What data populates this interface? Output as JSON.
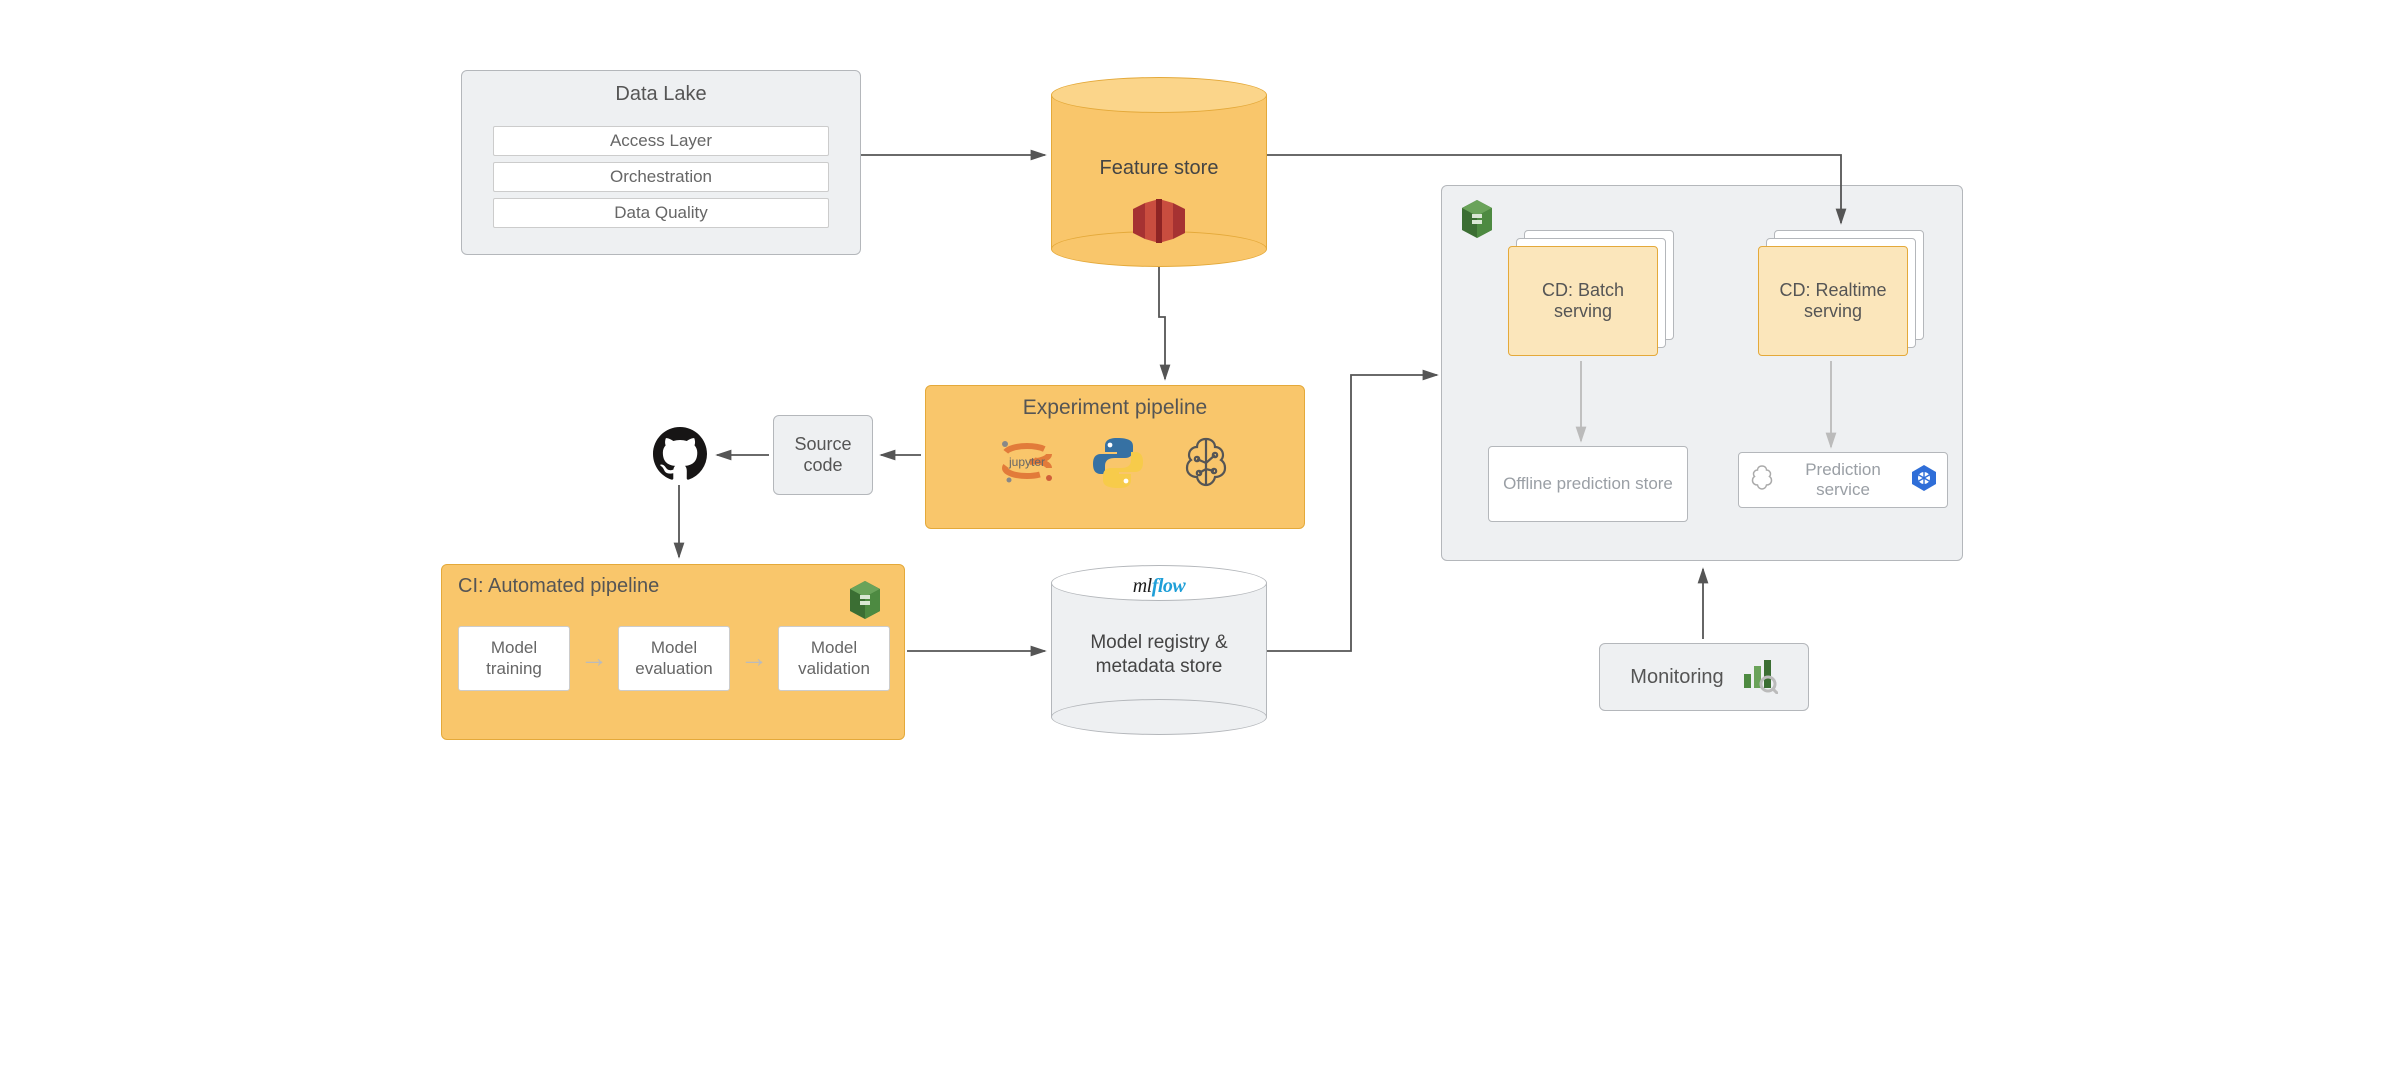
{
  "datalake": {
    "title": "Data Lake",
    "layers": [
      "Access Layer",
      "Orchestration",
      "Data Quality"
    ]
  },
  "feature_store": {
    "label": "Feature store"
  },
  "experiment": {
    "title": "Experiment pipeline",
    "icons": [
      "jupyter",
      "python",
      "ml-brain"
    ]
  },
  "source_code": {
    "label_line1": "Source",
    "label_line2": "code"
  },
  "ci": {
    "title": "CI: Automated pipeline",
    "stages": [
      "Model training",
      "Model evaluation",
      "Model validation"
    ]
  },
  "model_registry": {
    "logo": "mlflow",
    "label": "Model registry & metadata store"
  },
  "deploy": {
    "batch": "CD: Batch serving",
    "realtime": "CD: Realtime serving",
    "offline_pred": "Offline prediction store",
    "pred_service": "Prediction service"
  },
  "monitoring": {
    "label": "Monitoring"
  }
}
